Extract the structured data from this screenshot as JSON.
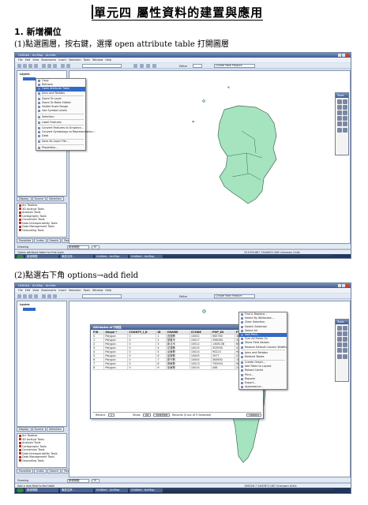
{
  "doc": {
    "title": "單元四 屬性資料的建置與應用",
    "section": "1. 新增欄位",
    "step1": "(1)點選圖層，按右鍵，選擇 open attribute table 打開圖層",
    "step2": "(2)點選右下角 options→add field"
  },
  "app": {
    "window_title": "Untitled - ArcMap - ArcInfo",
    "menu": [
      "File",
      "Edit",
      "View",
      "Bookmarks",
      "Insert",
      "Selection",
      "Tools",
      "Window",
      "Help"
    ],
    "editor_label": "Editor",
    "layer_dropdown": "Create New Feature",
    "toc_title": "Layers",
    "toc_tabs": [
      "Display",
      "Source",
      "Selection"
    ],
    "toolbox_tabs": [
      "Favorites",
      "Index",
      "Search",
      "Results"
    ],
    "drawing_label": "Drawing",
    "font_dropdown": "新細明體",
    "font_size": "10",
    "tools_title": "Tools",
    "toolbox_items": [
      "Arc Toolbox",
      "3D Analyst Tools",
      "Analysis Tools",
      "Cartography Tools",
      "Conversion Tools",
      "Data Interoperability Tools",
      "Data Management Tools",
      "Geocoding Tools"
    ],
    "status1": "Opens attribute table for this layer",
    "coords1": "221933.887 2544603.308 Unknown Units",
    "status2": "Add a new field to the table",
    "coords2": "198526.7 2467871.087 Unknown Units",
    "taskbar": [
      "新細明體",
      "東部沿岸...",
      "Untitled - ArcMap",
      "Untitled - ArcMap"
    ]
  },
  "context_menu": [
    {
      "label": "Copy"
    },
    {
      "label": "Remove"
    },
    {
      "label": "Open Attribute Table",
      "highlight": true
    },
    {
      "label": "Joins and Relates"
    },
    {
      "sep": true
    },
    {
      "label": "Zoom To Layer"
    },
    {
      "label": "Zoom To Make Visible"
    },
    {
      "label": "Visible Scale Range"
    },
    {
      "label": "Use Symbol Levels"
    },
    {
      "sep": true
    },
    {
      "label": "Selection"
    },
    {
      "sep": true
    },
    {
      "label": "Label Features"
    },
    {
      "sep": true
    },
    {
      "label": "Convert Features to Graphics..."
    },
    {
      "label": "Convert Symbology to Representation..."
    },
    {
      "label": "Data"
    },
    {
      "sep": true
    },
    {
      "label": "Save As Layer File..."
    },
    {
      "sep": true
    },
    {
      "label": "Properties..."
    }
  ],
  "options_menu": [
    {
      "label": "Find & Replace..."
    },
    {
      "label": "Select By Attributes..."
    },
    {
      "label": "Clear Selection"
    },
    {
      "label": "Switch Selection"
    },
    {
      "label": "Select All"
    },
    {
      "label": "Add Field...",
      "highlight": true
    },
    {
      "label": "Turn All Fields On"
    },
    {
      "label": "Show Field Aliases"
    },
    {
      "label": "Restore Default Column Widths"
    },
    {
      "sep": true
    },
    {
      "label": "Joins and Relates"
    },
    {
      "label": "Related Tables"
    },
    {
      "sep": true
    },
    {
      "label": "Create Graph..."
    },
    {
      "label": "Add Table to Layout"
    },
    {
      "label": "Reload Cache"
    },
    {
      "label": "Print..."
    },
    {
      "label": "Reports"
    },
    {
      "label": "Export..."
    },
    {
      "label": "Appearance..."
    }
  ],
  "attr_table": {
    "title": "Attributes of 行政區",
    "headers": [
      "FID",
      "Shape *",
      "COUNTY_I_D",
      "ID",
      "CNAME",
      "CCODE",
      "POP_83",
      "POP_1..."
    ],
    "rows": [
      [
        "0",
        "Polygon",
        "0",
        "1",
        "宜蘭縣",
        "10002",
        "565760",
        "388568"
      ],
      [
        "1",
        "Polygon",
        "0",
        "2",
        "基隆市",
        "10017",
        "356084",
        "344475"
      ],
      [
        "2",
        "Polygon",
        "0",
        "3",
        "新北市",
        "10012",
        "1308138",
        "6090413"
      ],
      [
        "3",
        "Polygon",
        "0",
        "4",
        "花蓮縣",
        "10015",
        "353950",
        "479597"
      ],
      [
        "4",
        "Polygon",
        "0",
        "5",
        "臺東縣",
        "10014",
        "95223",
        "94247"
      ],
      [
        "5",
        "Polygon",
        "0",
        "6",
        "苗栗縣",
        "10005",
        "2977",
        "4793"
      ],
      [
        "6",
        "Polygon",
        "0",
        "7",
        "新竹縣",
        "10004",
        "363692",
        "152108"
      ],
      [
        "7",
        "Polygon",
        "0",
        "8",
        "屏東縣",
        "10013",
        "750954",
        "908903"
      ],
      [
        "8",
        "Polygon",
        "0",
        "9",
        "臺東縣",
        "10014",
        "446",
        "240452"
      ]
    ],
    "record_label": "Record:",
    "record_value": "1",
    "show_label": "Show:",
    "all_btn": "All",
    "selected_btn": "Selected",
    "records_text": "Records (0 out of 9 Selected)",
    "options_btn": "Options"
  },
  "colors": {
    "land": "#a6e4c0",
    "land_stroke": "#3f6b52",
    "highlight": "#316ac5"
  }
}
